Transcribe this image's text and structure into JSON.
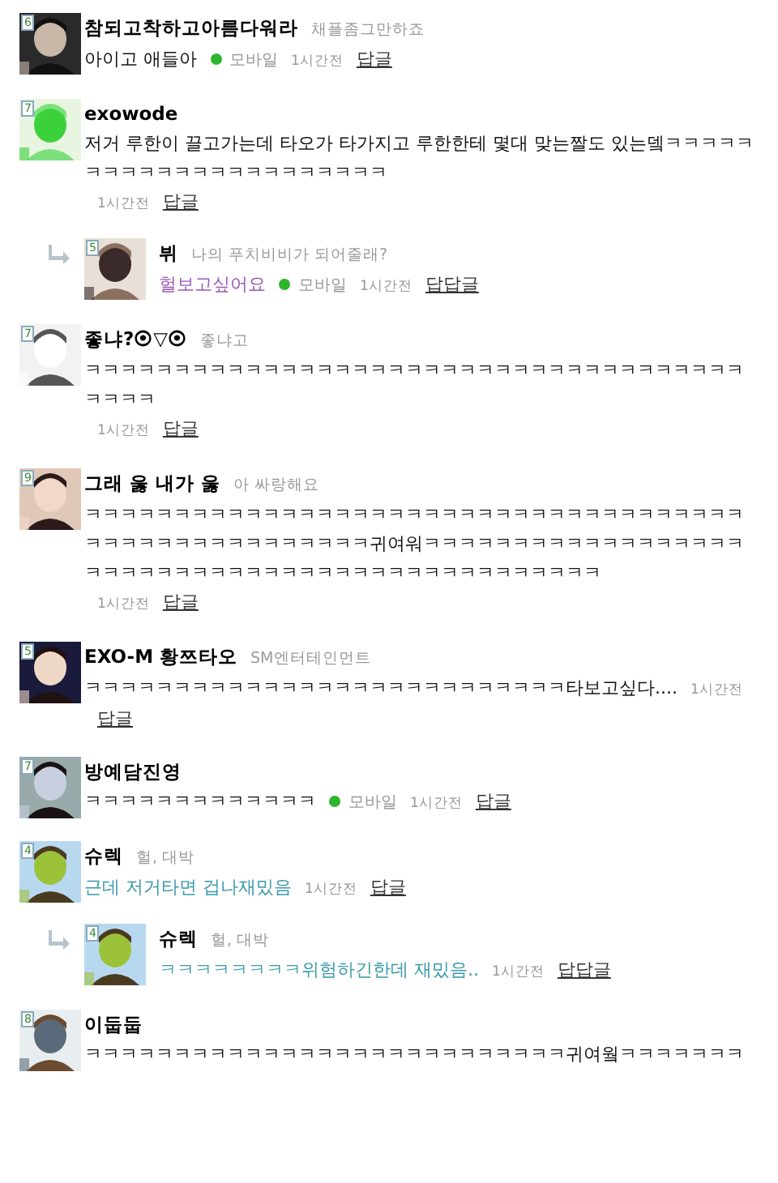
{
  "comments": [
    {
      "level": "6",
      "name": "참되고착하고아름다워라",
      "status": "채플좀그만하죠",
      "body": "아이고 애들아",
      "color": "#111111",
      "device": "모바일",
      "time": "1시간전",
      "reply": "답글"
    },
    {
      "level": "7",
      "name": "exowode",
      "body": "저거 루한이 끌고가는데 타오가 타가지고 루한한테 몇대 맞는짤도 있는뎈ㅋㅋㅋㅋㅋㅋㅋㅋㅋㅋㅋㅋㅋㅋㅋㅋㅋㅋㅋㅋㅋㅋ",
      "color": "#111111",
      "time": "1시간전",
      "reply": "답글",
      "children": [
        {
          "level": "5",
          "name": "뷔",
          "status": "나의 푸치비비가 되어줄래?",
          "body": "헐보고싶어요",
          "color": "#9b59b6",
          "device": "모바일",
          "time": "1시간전",
          "reply": "답답글"
        }
      ]
    },
    {
      "level": "7",
      "name": "좋냐?⦿▽⦿",
      "status": "좋냐고",
      "body": "ㅋㅋㅋㅋㅋㅋㅋㅋㅋㅋㅋㅋㅋㅋㅋㅋㅋㅋㅋㅋㅋㅋㅋㅋㅋㅋㅋㅋㅋㅋㅋㅋㅋㅋㅋㅋㅋㅋㅋㅋㅋ",
      "color": "#111111",
      "time": "1시간전",
      "reply": "답글"
    },
    {
      "level": "9",
      "name": "그래 욿 내가 욿",
      "status": "아 싸랑해요",
      "body": "ㅋㅋㅋㅋㅋㅋㅋㅋㅋㅋㅋㅋㅋㅋㅋㅋㅋㅋㅋㅋㅋㅋㅋㅋㅋㅋㅋㅋㅋㅋㅋㅋㅋㅋㅋㅋㅋㅋㅋㅋㅋㅋㅋㅋㅋㅋㅋㅋㅋㅋㅋㅋㅋ귀여워ㅋㅋㅋㅋㅋㅋㅋㅋㅋㅋㅋㅋㅋㅋㅋㅋㅋㅋㅋㅋㅋㅋㅋㅋㅋㅋㅋㅋㅋㅋㅋㅋㅋㅋㅋㅋㅋㅋㅋㅋㅋㅋㅋㅋㅋㅋㅋ",
      "color": "#111111",
      "time": "1시간전",
      "reply": "답글"
    },
    {
      "level": "5",
      "name": "EXO-M 황쯔타오",
      "status": "SM엔터테인먼트",
      "body": "ㅋㅋㅋㅋㅋㅋㅋㅋㅋㅋㅋㅋㅋㅋㅋㅋㅋㅋㅋㅋㅋㅋㅋㅋㅋㅋㅋ타보고싶다....",
      "color": "#111111",
      "time": "1시간전",
      "reply": "답글"
    },
    {
      "level": "7",
      "name": "방예담진영",
      "body": "ㅋㅋㅋㅋㅋㅋㅋㅋㅋㅋㅋㅋㅋ",
      "color": "#111111",
      "device": "모바일",
      "time": "1시간전",
      "reply": "답글"
    },
    {
      "level": "4",
      "name": "슈렉",
      "status": "헐, 대박",
      "body": "근데 저거타면 겁나재밌음",
      "color": "#3a9aa8",
      "time": "1시간전",
      "reply": "답글",
      "children": [
        {
          "level": "4",
          "name": "슈렉",
          "status": "헐, 대박",
          "body": "ㅋㅋㅋㅋㅋㅋㅋㅋ위험하긴한데 재밌음..",
          "color": "#3a9aa8",
          "time": "1시간전",
          "reply": "답답글"
        }
      ]
    },
    {
      "level": "8",
      "name": "이둡둡",
      "body": "ㅋㅋㅋㅋㅋㅋㅋㅋㅋㅋㅋㅋㅋㅋㅋㅋㅋㅋㅋㅋㅋㅋㅋㅋㅋㅋㅋ귀여웤ㅋㅋㅋㅋㅋㅋㅋ",
      "color": "#111111"
    }
  ]
}
